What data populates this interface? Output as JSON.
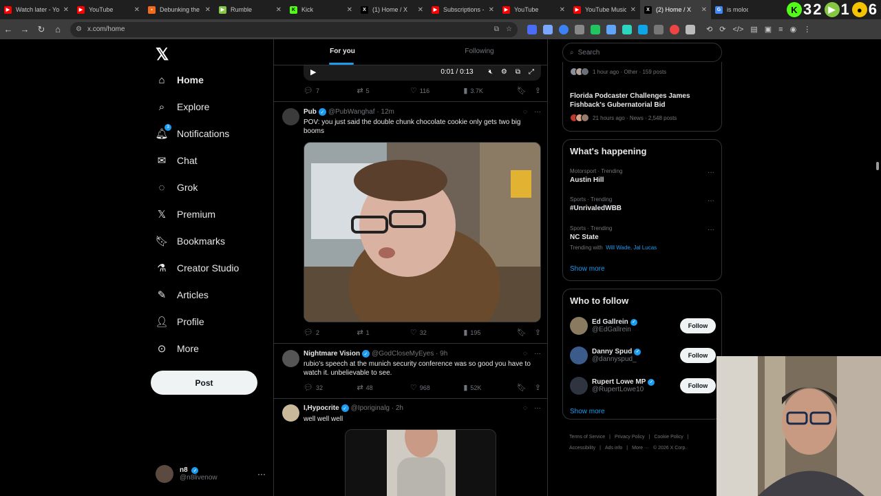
{
  "browser": {
    "tabs": [
      {
        "label": "Watch later - Yo",
        "color": "#ff0000",
        "glyph": "▶",
        "active": false
      },
      {
        "label": "YouTube",
        "color": "#ff0000",
        "glyph": "▶",
        "active": false
      },
      {
        "label": "Debunking the",
        "color": "#f26b1d",
        "glyph": "▪",
        "active": false
      },
      {
        "label": "Rumble",
        "color": "#85c742",
        "glyph": "▶",
        "active": false
      },
      {
        "label": "Kick",
        "color": "#53fc18",
        "glyph": "K",
        "active": false
      },
      {
        "label": "(1) Home / X",
        "color": "#000000",
        "glyph": "X",
        "active": false
      },
      {
        "label": "Subscriptions -",
        "color": "#ff0000",
        "glyph": "▶",
        "active": false
      },
      {
        "label": "YouTube",
        "color": "#ff0000",
        "glyph": "▶",
        "active": false
      },
      {
        "label": "YouTube Music",
        "color": "#ff0000",
        "glyph": "▶",
        "active": false
      },
      {
        "label": "(2) Home / X",
        "color": "#000000",
        "glyph": "X",
        "active": true
      },
      {
        "label": "is moloch",
        "color": "#4285f4",
        "glyph": "G",
        "active": false
      }
    ],
    "overlay": {
      "kick_count": "3",
      "kick_count2": "2",
      "rumble_count": "1",
      "other_count": "6"
    },
    "url": "x.com/home"
  },
  "nav": {
    "items": [
      {
        "label": "Home",
        "icon": "home-icon"
      },
      {
        "label": "Explore",
        "icon": "search-icon"
      },
      {
        "label": "Notifications",
        "icon": "bell-icon"
      },
      {
        "label": "Chat",
        "icon": "mail-icon"
      },
      {
        "label": "Grok",
        "icon": "grok-icon"
      },
      {
        "label": "Premium",
        "icon": "x-icon"
      },
      {
        "label": "Bookmarks",
        "icon": "bookmark-icon"
      },
      {
        "label": "Creator Studio",
        "icon": "flask-icon"
      },
      {
        "label": "Articles",
        "icon": "article-icon"
      },
      {
        "label": "Profile",
        "icon": "person-icon"
      },
      {
        "label": "More",
        "icon": "more-circle-icon"
      }
    ],
    "notifications_badge": "3",
    "post_label": "Post",
    "me": {
      "name": "n8",
      "handle": "@n8livenow"
    }
  },
  "feed": {
    "tabs": [
      "For you",
      "Following"
    ],
    "video_time": "0:01 / 0:13",
    "tweet0_stats": {
      "replies": "7",
      "reposts": "5",
      "likes": "116",
      "views": "3.7K"
    },
    "tweets": [
      {
        "name": "Pub",
        "handle": "@PubWanghaf",
        "time": "12m",
        "text": "POV: you just said the double chunk chocolate cookie only gets two big booms",
        "stats": {
          "replies": "2",
          "reposts": "1",
          "likes": "32",
          "views": "195"
        }
      },
      {
        "name": "Nightmare Vision",
        "handle": "@GodCloseMyEyes",
        "time": "9h",
        "text": "rubio's speech at the munich security conference was so good you have to watch it. unbelievable to see.",
        "stats": {
          "replies": "32",
          "reposts": "48",
          "likes": "968",
          "views": "52K"
        }
      },
      {
        "name": "I,Hypocrite",
        "handle": "@Iporiginalg",
        "time": "2h",
        "text": "well well well"
      }
    ]
  },
  "sidebar": {
    "search_placeholder": "Search",
    "news": [
      {
        "meta": "1 hour ago · Other · 159 posts"
      },
      {
        "title": "Florida Podcaster Challenges James Fishback's Gubernatorial Bid",
        "meta": "21 hours ago · News · 2,548 posts"
      }
    ],
    "happening": {
      "title": "What's happening",
      "trends": [
        {
          "context": "Motorsport · Trending",
          "name": "Austin Hill"
        },
        {
          "context": "Sports · Trending",
          "name": "#UnrivaledWBB"
        },
        {
          "context": "Sports · Trending",
          "name": "NC State",
          "with_label": "Trending with",
          "with": "Will Wade, Jal Lucas"
        }
      ],
      "show_more": "Show more"
    },
    "who_to_follow": {
      "title": "Who to follow",
      "accounts": [
        {
          "name": "Ed Gallrein",
          "handle": "@EdGallrein",
          "button": "Follow"
        },
        {
          "name": "Danny Spud",
          "handle": "@dannyspud_",
          "button": "Follow"
        },
        {
          "name": "Rupert Lowe MP",
          "handle": "@RupertLowe10",
          "button": "Follow"
        }
      ],
      "show_more": "Show more"
    },
    "footer": {
      "line1": [
        "Terms of Service",
        "|",
        "Privacy Policy",
        "|",
        "Cookie Policy",
        "|"
      ],
      "line2": [
        "Accessibility",
        "|",
        "Ads info",
        "|",
        "More ···",
        "© 2026 X Corp."
      ]
    }
  }
}
